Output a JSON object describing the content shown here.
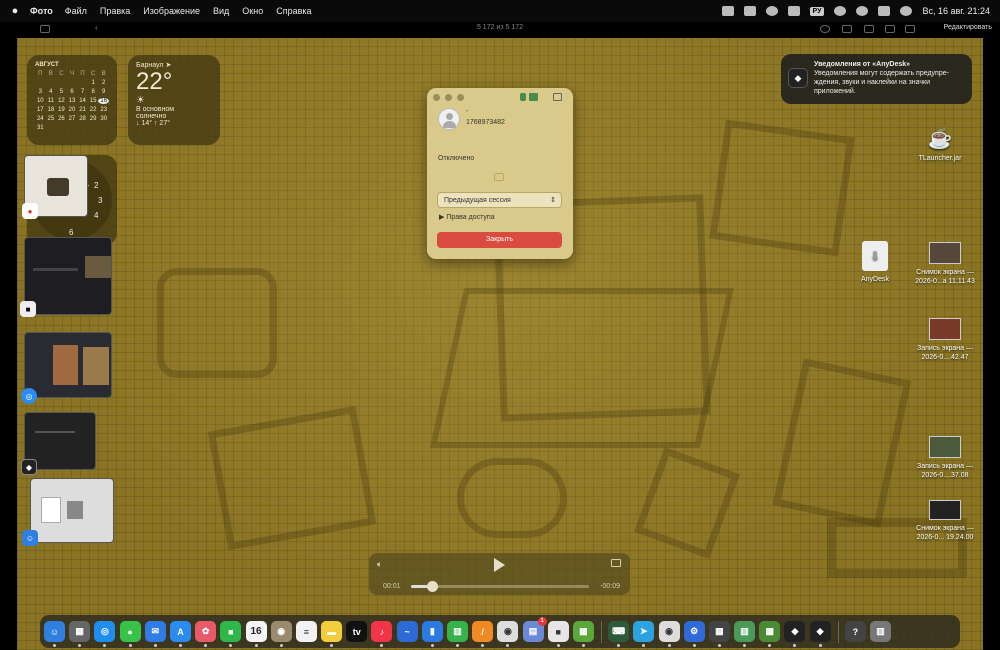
{
  "menubar": {
    "app": "Фото",
    "items": [
      "Файл",
      "Правка",
      "Изображение",
      "Вид",
      "Окно",
      "Справка"
    ],
    "input_lang": "РУ",
    "datetime": "Вс, 16 авг.  21:24"
  },
  "viewer": {
    "count": "5 172 из 5 172",
    "edit_label": "Редактировать"
  },
  "calendar": {
    "month": "АВГУСТ",
    "weekdays": [
      "П",
      "В",
      "С",
      "Ч",
      "П",
      "С",
      "В"
    ],
    "days": [
      "",
      "",
      "",
      "",
      "",
      "1",
      "2",
      "3",
      "4",
      "5",
      "6",
      "7",
      "8",
      "9",
      "10",
      "11",
      "12",
      "13",
      "14",
      "15",
      "16",
      "17",
      "18",
      "19",
      "20",
      "21",
      "22",
      "23",
      "24",
      "25",
      "26",
      "27",
      "28",
      "29",
      "30",
      "31"
    ],
    "today": "16"
  },
  "weather": {
    "city": "Барнаул",
    "temp": "22°",
    "condition_line1": "В основном",
    "condition_line2": "солнечно",
    "range": "↓ 14° ↑ 27°"
  },
  "notification": {
    "title": "Уведомления от «AnyDesk»",
    "body": "Уведомления могут содержать предупре-ждения, звуки и наклейки на значки приложений."
  },
  "anydesk": {
    "name": "-",
    "address": "1768973482",
    "status": "Отключено",
    "session_select": "Предыдущая сессия",
    "permissions": "Права доступа",
    "close_button": "Закрыть"
  },
  "desktop_icons": [
    {
      "label1": "TLauncher.jar",
      "label2": ""
    },
    {
      "label1": "AnyDesk",
      "label2": ""
    },
    {
      "label1": "Снимок экрана —",
      "label2": "2026-0...а 11.11.43"
    },
    {
      "label1": "Запись экрана —",
      "label2": "2026-0....42.47"
    },
    {
      "label1": "Запись экрана —",
      "label2": "2026-0....37.08"
    },
    {
      "label1": "Снимок экрана —",
      "label2": "2026-0... 19.24.00"
    }
  ],
  "video": {
    "elapsed": "00:01",
    "remaining": "-00:09",
    "progress": 0.12
  },
  "dock": [
    {
      "name": "finder-icon",
      "color": "#2f7fe0"
    },
    {
      "name": "launchpad-icon",
      "color": "#666666"
    },
    {
      "name": "safari-icon",
      "color": "#1f8ef1"
    },
    {
      "name": "messages-icon",
      "color": "#37c24a"
    },
    {
      "name": "mail-icon",
      "color": "#2f7ce6"
    },
    {
      "name": "appstore-icon",
      "color": "#2a8cf0"
    },
    {
      "name": "photos-icon",
      "color": "#e85a6a"
    },
    {
      "name": "facetime-icon",
      "color": "#2fb84a"
    },
    {
      "name": "calendar-icon",
      "color": "#f5f5f5"
    },
    {
      "name": "contacts-icon",
      "color": "#9a8a70"
    },
    {
      "name": "reminders-icon",
      "color": "#f2f2f2"
    },
    {
      "name": "notes-icon",
      "color": "#f2cc3b"
    },
    {
      "name": "appletv-icon",
      "color": "#111111"
    },
    {
      "name": "music-icon",
      "color": "#f2344a"
    },
    {
      "name": "freeform-icon",
      "color": "#2e6ad6"
    },
    {
      "name": "keynote-icon",
      "color": "#2a7ae2"
    },
    {
      "name": "numbers-icon",
      "color": "#35b34a"
    },
    {
      "name": "pages-icon",
      "color": "#f08a24"
    },
    {
      "name": "chrome-icon",
      "color": "#dddddd"
    },
    {
      "name": "preview-icon",
      "color": "#6a8ad8"
    },
    {
      "name": "roblox-icon",
      "color": "#e6e6e6"
    },
    {
      "name": "minecraft-icon",
      "color": "#5aa83a"
    },
    {
      "name": "sep",
      "color": ""
    },
    {
      "name": "terminal-app-icon",
      "color": "#2f5a3a"
    },
    {
      "name": "telegram-icon",
      "color": "#2aa3e0"
    },
    {
      "name": "chrome-running-icon",
      "color": "#dddddd"
    },
    {
      "name": "settings-icon",
      "color": "#2f6ad8"
    },
    {
      "name": "calculator-icon",
      "color": "#444444"
    },
    {
      "name": "games-icon",
      "color": "#4a9a5a"
    },
    {
      "name": "minecraft-running-icon",
      "color": "#4a8a34"
    },
    {
      "name": "anydesk-icon",
      "color": "#222222"
    },
    {
      "name": "anydesk-2-icon",
      "color": "#222222"
    },
    {
      "name": "sep",
      "color": ""
    },
    {
      "name": "help-icon",
      "color": "#444444"
    },
    {
      "name": "trash-icon",
      "color": "#777777"
    }
  ],
  "calendar_dock_day": "16",
  "telegram_badge": "1"
}
